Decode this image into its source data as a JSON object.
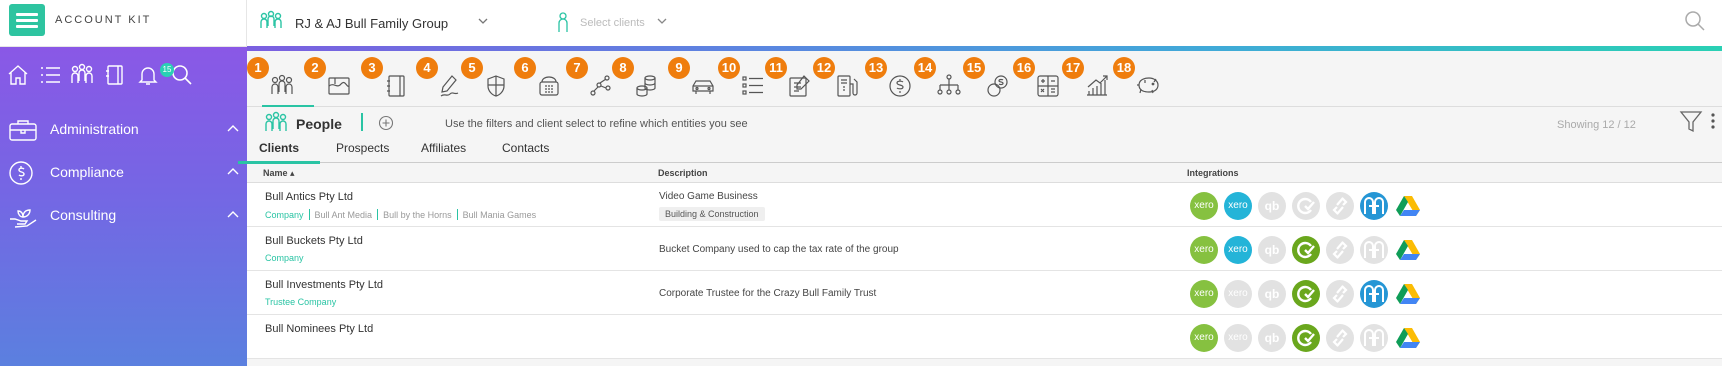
{
  "app": {
    "logo_text": "ACCOUNT KIT"
  },
  "topbar": {
    "group_name": "RJ & AJ Bull Family Group",
    "client_select_placeholder": "Select clients"
  },
  "sidebar": {
    "icons": [
      "home-icon",
      "list-icon",
      "people-icon",
      "book-icon",
      "bell-icon",
      "search-icon"
    ],
    "notification_count": "15",
    "items": [
      {
        "label": "Administration",
        "icon": "briefcase-icon"
      },
      {
        "label": "Compliance",
        "icon": "dollar-circle-icon"
      },
      {
        "label": "Consulting",
        "icon": "hand-plant-icon"
      }
    ]
  },
  "nav_tabs": [
    "1",
    "2",
    "3",
    "4",
    "5",
    "6",
    "7",
    "8",
    "9",
    "10",
    "11",
    "12",
    "13",
    "14",
    "15",
    "16",
    "17",
    "18"
  ],
  "nav_tab_icons": [
    "people-icon",
    "globe-map-icon",
    "notebook-icon",
    "pen-signature-icon",
    "shield-icon",
    "phone-icon",
    "network-nodes-icon",
    "coins-stack-icon",
    "car-icon",
    "list-icon",
    "edit-document-icon",
    "fuel-icon",
    "dollar-icon",
    "org-chart-icon",
    "coins-dollar-icon",
    "calculator-icon",
    "growth-chart-icon",
    "piggy-bank-icon"
  ],
  "people": {
    "title": "People",
    "filter_hint": "Use the filters and client select to refine which entities you see",
    "showing": "Showing 12 / 12"
  },
  "subtabs": [
    "Clients",
    "Prospects",
    "Affiliates",
    "Contacts"
  ],
  "columns": {
    "name": "Name ▴",
    "description": "Description",
    "integrations": "Integrations"
  },
  "rows": [
    {
      "name": "Bull Antics Pty Ltd",
      "types": [
        "Company",
        "Bull Ant Media",
        "Bull by the Horns",
        "Bull Mania Games"
      ],
      "description": "Video Game Business",
      "tag": "Building & Construction",
      "integrations": [
        1,
        1,
        0,
        0,
        0,
        1,
        1
      ]
    },
    {
      "name": "Bull Buckets Pty Ltd",
      "types": [
        "Company"
      ],
      "description": "Bucket Company used to cap the tax rate of the group",
      "tag": "",
      "integrations": [
        1,
        1,
        0,
        1,
        0,
        0,
        1
      ]
    },
    {
      "name": "Bull Investments Pty Ltd",
      "types": [
        "Trustee Company"
      ],
      "description": "Corporate Trustee for the Crazy Bull Family Trust",
      "tag": "",
      "integrations": [
        1,
        0,
        0,
        1,
        0,
        1,
        1
      ]
    },
    {
      "name": "Bull Nominees Pty Ltd",
      "types": [],
      "description": "",
      "tag": "",
      "integrations": [
        1,
        0,
        0,
        1,
        0,
        0,
        1
      ]
    }
  ],
  "integration_names": [
    "xero-icon",
    "xero-practice-icon",
    "quickbooks-icon",
    "class-super-icon",
    "link-integration-icon",
    "hub-people-icon",
    "google-drive-icon"
  ],
  "integration_labels": [
    "xero",
    "xero",
    "qb",
    "",
    "",
    "",
    ""
  ],
  "colors": {
    "accent": "#2ac4a4",
    "badge": "#ef7d0d",
    "xero_green": "#86c140",
    "xero_blue": "#24b4d8",
    "disabled": "#e2e2e2"
  }
}
